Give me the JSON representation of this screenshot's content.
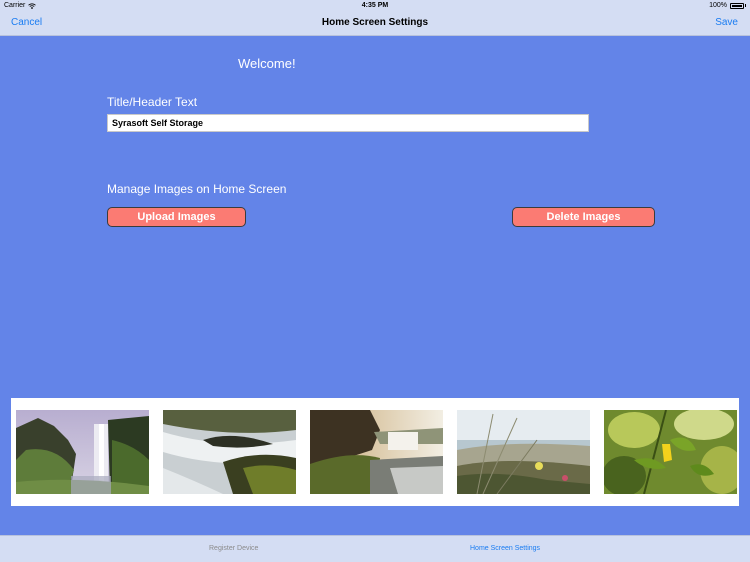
{
  "status_bar": {
    "carrier": "Carrier",
    "time": "4:35 PM",
    "battery": "100%"
  },
  "nav_bar": {
    "cancel_label": "Cancel",
    "title": "Home Screen Settings",
    "save_label": "Save"
  },
  "main": {
    "welcome": "Welcome!",
    "title_label": "Title/Header Text",
    "title_value": "Syrasoft Self Storage",
    "manage_label": "Manage Images on Home Screen",
    "upload_label": "Upload Images",
    "delete_label": "Delete Images"
  },
  "gallery": {
    "images": [
      "waterfall-cliff",
      "river-rapids",
      "waterfall-valley",
      "dune-grass",
      "yellow-flower-leaves"
    ]
  },
  "tab_bar": {
    "items": [
      {
        "label": "Register Device",
        "active": false
      },
      {
        "label": "Home Screen Settings",
        "active": true
      }
    ]
  },
  "colors": {
    "background": "#6384e8",
    "bar": "#d4ddf3",
    "accent": "#1a7cf2",
    "button": "#fb7b73"
  }
}
